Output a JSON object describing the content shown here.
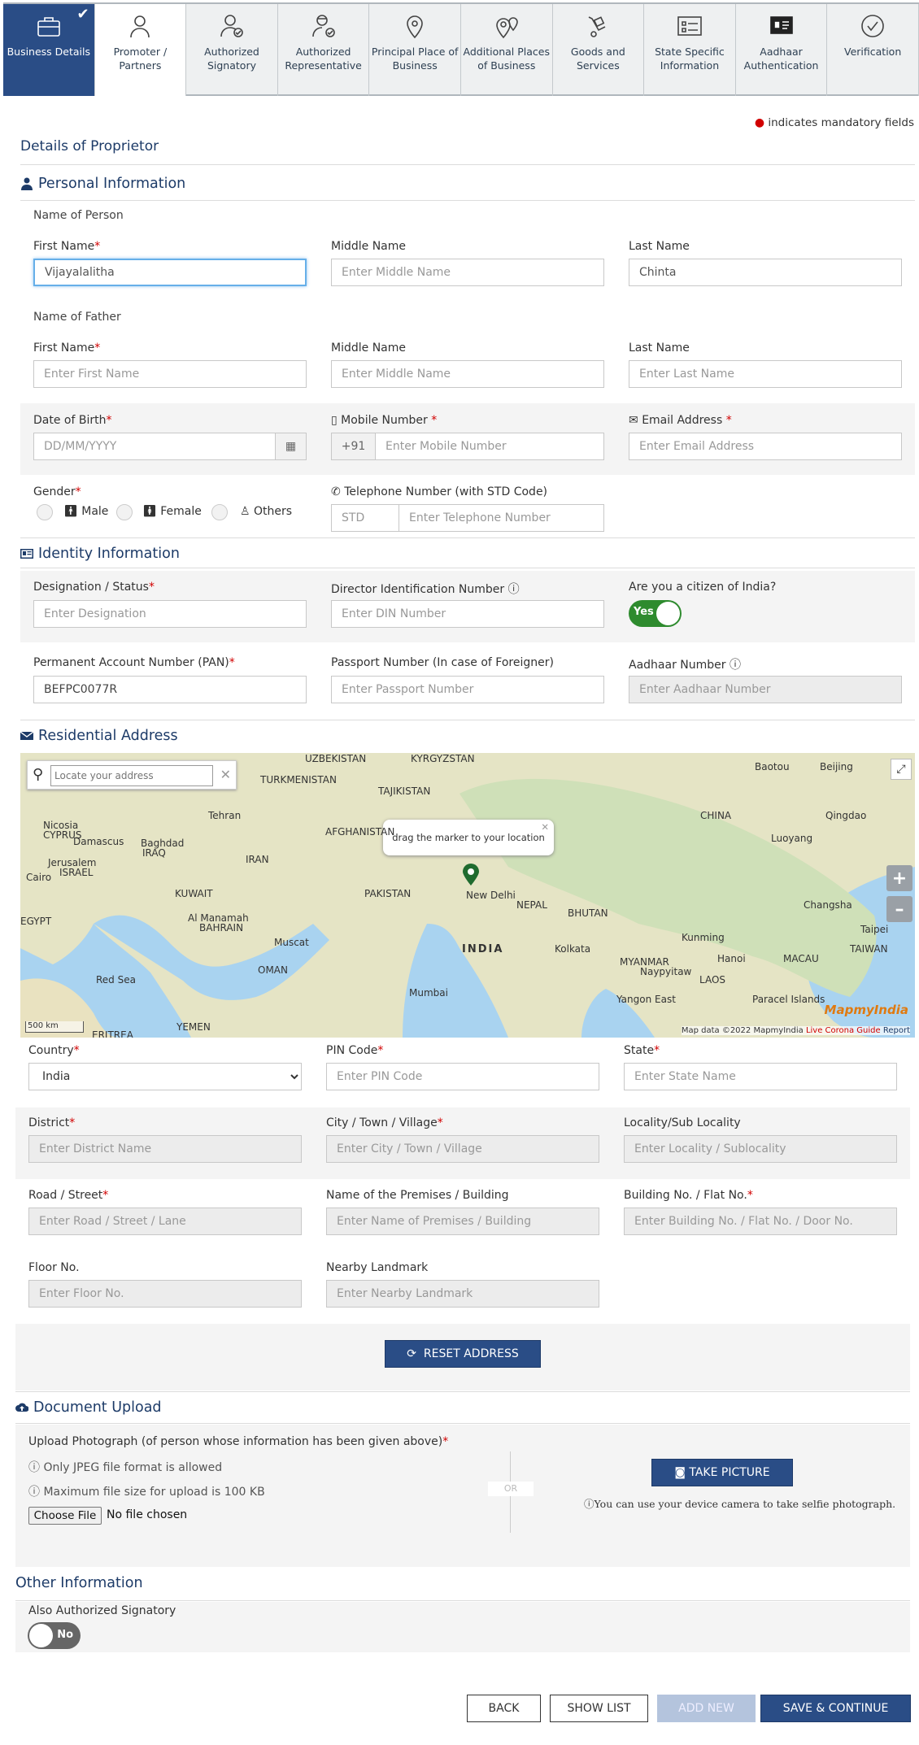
{
  "steps": [
    {
      "label": "Business Details"
    },
    {
      "label": "Promoter / Partners"
    },
    {
      "label": "Authorized Signatory"
    },
    {
      "label": "Authorized Representative"
    },
    {
      "label": "Principal Place of Business"
    },
    {
      "label": "Additional Places of Business"
    },
    {
      "label": "Goods and Services"
    },
    {
      "label": "State Specific Information"
    },
    {
      "label": "Aadhaar Authentication"
    },
    {
      "label": "Verification"
    }
  ],
  "mandatory_note": "indicates mandatory fields",
  "page_heading": "Details of Proprietor",
  "personal": {
    "title": "Personal Information",
    "name_of_person": "Name of Person",
    "first_name_label": "First Name",
    "first_name_value": "Vijayalalitha",
    "middle_name_label": "Middle Name",
    "middle_name_placeholder": "Enter Middle Name",
    "last_name_label": "Last Name",
    "last_name_value": "Chinta",
    "name_of_father": "Name of Father",
    "father_first_placeholder": "Enter First Name",
    "father_last_placeholder": "Enter Last Name",
    "dob_label": "Date of Birth",
    "dob_placeholder": "DD/MM/YYYY",
    "mobile_label": "Mobile Number",
    "mobile_prefix": "+91",
    "mobile_placeholder": "Enter Mobile Number",
    "email_label": "Email Address",
    "email_placeholder": "Enter Email Address",
    "gender_label": "Gender",
    "gender_options": [
      "Male",
      "Female",
      "Others"
    ],
    "telephone_label": "Telephone Number (with STD Code)",
    "std_placeholder": "STD",
    "telephone_placeholder": "Enter Telephone Number"
  },
  "identity": {
    "title": "Identity Information",
    "designation_label": "Designation / Status",
    "designation_placeholder": "Enter Designation",
    "din_label": "Director Identification Number",
    "din_placeholder": "Enter DIN Number",
    "citizen_label": "Are you a citizen of India?",
    "citizen_toggle": "Yes",
    "pan_label": "Permanent Account Number (PAN)",
    "pan_value": "BEFPC0077R",
    "passport_label": "Passport Number (In case of Foreigner)",
    "passport_placeholder": "Enter Passport Number",
    "aadhaar_label": "Aadhaar Number",
    "aadhaar_placeholder": "Enter Aadhaar Number"
  },
  "address": {
    "title": "Residential Address",
    "map_search_placeholder": "Locate your address",
    "map_popup": "drag the marker to your location",
    "map_scale": "500 km",
    "map_attribution": "Map data ©2022 MapmyIndia",
    "map_attribution_red": "Live Corona Guide",
    "map_attribution_report": "Report",
    "map_brand": "MapmyIndia",
    "map_labels": [
      "UZBEKISTAN",
      "KYRGYZSTAN",
      "TURKMENISTAN",
      "TAJIKISTAN",
      "Baotou",
      "Beijing",
      "Tehran",
      "AFGHANISTAN",
      "Nicosia",
      "CYPRUS",
      "Damascus",
      "Baghdad",
      "IRAQ",
      "IRAN",
      "Jerusalem",
      "ISRAEL",
      "Cairo",
      "KUWAIT",
      "PAKISTAN",
      "New Delhi",
      "NEPAL",
      "BHUTAN",
      "CHINA",
      "Qingdao",
      "Luoyang",
      "Changsha",
      "Taipei",
      "TAIWAN",
      "EGYPT",
      "Al Manamah",
      "BAHRAIN",
      "Muscat",
      "OMAN",
      "INDIA",
      "Kolkata",
      "MYANMAR",
      "Naypyitaw",
      "Kunming",
      "Hanoi",
      "MACAU",
      "LAOS",
      "Mumbai",
      "Yangon East",
      "Paracel Islands",
      "Red Sea",
      "YEMEN",
      "ERITREA"
    ],
    "country_label": "Country",
    "country_value": "India",
    "pin_label": "PIN Code",
    "pin_placeholder": "Enter PIN Code",
    "state_label": "State",
    "state_placeholder": "Enter State Name",
    "district_label": "District",
    "district_placeholder": "Enter District Name",
    "city_label": "City / Town / Village",
    "city_placeholder": "Enter City / Town / Village",
    "locality_label": "Locality/Sub Locality",
    "locality_placeholder": "Enter Locality / Sublocality",
    "road_label": "Road / Street",
    "road_placeholder": "Enter Road / Street / Lane",
    "premises_label": "Name of the Premises / Building",
    "premises_placeholder": "Enter Name of Premises / Building",
    "building_label": "Building No. / Flat No.",
    "building_placeholder": "Enter Building No. / Flat No. / Door No.",
    "floor_label": "Floor No.",
    "floor_placeholder": "Enter Floor No.",
    "landmark_label": "Nearby Landmark",
    "landmark_placeholder": "Enter Nearby Landmark",
    "reset_button": "RESET ADDRESS"
  },
  "upload": {
    "title": "Document Upload",
    "photo_label": "Upload Photograph (of person whose information has been given above)",
    "note1": "Only JPEG file format is allowed",
    "note2": "Maximum file size for upload is 100 KB",
    "choose_file": "Choose File",
    "no_file": "No file chosen",
    "or": "OR",
    "take_picture": "TAKE PICTURE",
    "camera_note": "You can use your device camera to take selfie photograph."
  },
  "other": {
    "title": "Other Information",
    "also_signatory": "Also Authorized Signatory",
    "toggle": "No"
  },
  "footer": {
    "back": "BACK",
    "show_list": "SHOW LIST",
    "add_new": "ADD NEW",
    "save_continue": "SAVE & CONTINUE"
  },
  "colors": {
    "primary": "#2a4d86",
    "required": "#d10000",
    "toggle_on": "#2e8b2e"
  }
}
